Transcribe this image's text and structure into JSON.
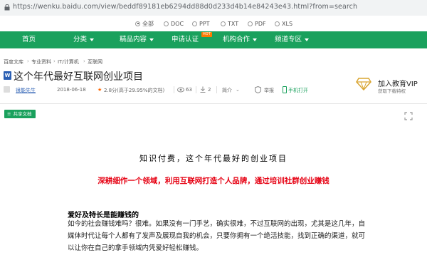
{
  "browser": {
    "url": "https://wenku.baidu.com/view/beddf89181eb6294dd88d0d233d4b14e84243e43.html?from=search"
  },
  "filters": [
    {
      "label": "全部",
      "selected": true
    },
    {
      "label": "DOC",
      "selected": false
    },
    {
      "label": "PPT",
      "selected": false
    },
    {
      "label": "TXT",
      "selected": false
    },
    {
      "label": "PDF",
      "selected": false
    },
    {
      "label": "XLS",
      "selected": false
    }
  ],
  "nav": {
    "home": "首页",
    "category": "分类",
    "premium": "精品内容",
    "certify": "申请认证",
    "certify_badge": "HOT",
    "org": "机构合作",
    "channel": "频道专区"
  },
  "breadcrumb": [
    "百度文库",
    "专业资料",
    "IT/计算机",
    "互联网"
  ],
  "doc": {
    "type_icon": "W",
    "title": "这个年代最好互联网创业项目",
    "author": "很能先生",
    "date": "2018-06-18",
    "rating": "2.8分(高于29.95%的文档)",
    "views": "63",
    "downloads": "2",
    "summary_label": "简介",
    "report": "举报",
    "mobile": "手机打开"
  },
  "vip": {
    "title": "加入教育VIP",
    "subtitle": "获取下载特权"
  },
  "panel": {
    "tag": "共享文档"
  },
  "content": {
    "heading": "知识付费，这个年代最好的创业项目",
    "highlight": "深耕细作一个领域，利用互联网打造个人品牌，通过培训社群创业赚钱",
    "subheading": "爱好及特长是能赚钱的",
    "paragraph": "如今的社会赚钱难吗？很难。如果没有一门手艺，确实很难，不过互联网的出现，尤其是这几年，自媒体时代让每个人都有了发声及展现自我的机会，只要你拥有一个绝活技能，找到正确的渠道，就可以让你在自己的拿手领域内凭爱好轻松赚钱。"
  },
  "colors": {
    "brand_green": "#1aa15d",
    "highlight_red": "#e60012",
    "vip_gold": "#d9a531"
  }
}
